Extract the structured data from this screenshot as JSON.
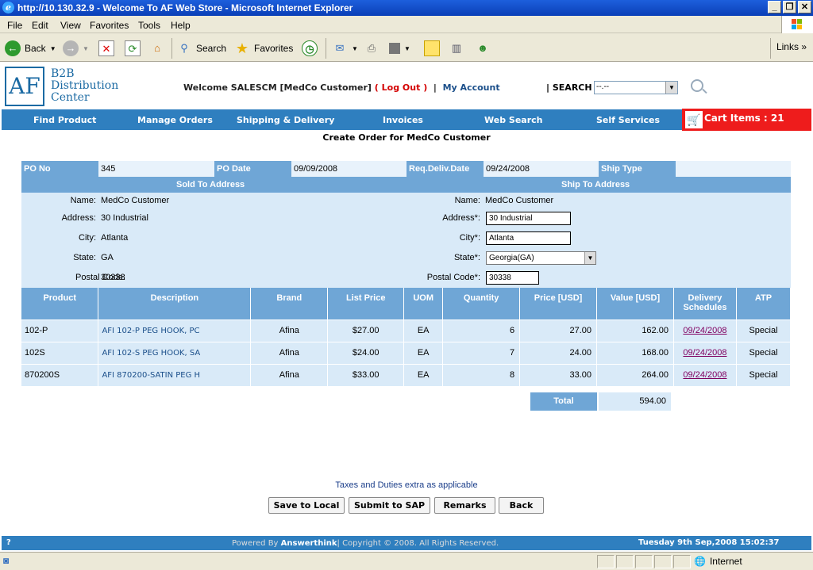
{
  "window": {
    "title": "http://10.130.32.9 - Welcome To AF Web Store - Microsoft Internet Explorer"
  },
  "menubar": [
    "File",
    "Edit",
    "View",
    "Favorites",
    "Tools",
    "Help"
  ],
  "toolbar": {
    "back": "Back",
    "search": "Search",
    "favorites": "Favorites",
    "links": "Links"
  },
  "header": {
    "logo_mark": "AF",
    "logo_line1": "B2B",
    "logo_line2": "Distribution",
    "logo_line3": "Center",
    "welcome": "Welcome SALESCM [MedCo Customer]",
    "logout": "( Log Out )",
    "sep1": "|",
    "my_account": "My Account",
    "sep2": "|",
    "search_label": "SEARCH",
    "search_value": "--.--"
  },
  "nav": {
    "items": [
      "Find Product",
      "Manage Orders",
      "Shipping & Delivery",
      "Invoices",
      "Web Search",
      "Self Services"
    ],
    "cart_label": "Cart Items : 21"
  },
  "page_title": "Create Order for MedCo Customer",
  "po": {
    "po_no_label": "PO No",
    "po_no": "345",
    "po_date_label": "PO Date",
    "po_date": "09/09/2008",
    "req_label": "Req.Deliv.Date",
    "req_date": "09/24/2008",
    "ship_type_label": "Ship Type",
    "ship_type": ""
  },
  "sold_to": {
    "heading": "Sold To Address",
    "name_label": "Name:",
    "name": "MedCo Customer",
    "address_label": "Address:",
    "address": "30 Industrial",
    "city_label": "City:",
    "city": "Atlanta",
    "state_label": "State:",
    "state": "GA",
    "postal_label": "Postal Code:",
    "postal": "30338"
  },
  "ship_to": {
    "heading": "Ship To Address",
    "name_label": "Name:",
    "name": "MedCo Customer",
    "address_label": "Address*:",
    "address": "30 Industrial",
    "city_label": "City*:",
    "city": "Atlanta",
    "state_label": "State*:",
    "state": "Georgia(GA)",
    "postal_label": "Postal Code*:",
    "postal": "30338"
  },
  "table": {
    "headers": [
      "Product",
      "Description",
      "Brand",
      "List Price",
      "UOM",
      "Quantity",
      "Price [USD]",
      "Value [USD]",
      "Delivery Schedules",
      "ATP"
    ],
    "rows": [
      [
        "102-P",
        "AFI 102-P PEG HOOK, PC",
        "Afina",
        "$27.00",
        "EA",
        "6",
        "27.00",
        "162.00",
        "09/24/2008",
        "Special"
      ],
      [
        "102S",
        "AFI 102-S PEG HOOK, SA",
        "Afina",
        "$24.00",
        "EA",
        "7",
        "24.00",
        "168.00",
        "09/24/2008",
        "Special"
      ],
      [
        "870200S",
        "AFI 870200-SATIN PEG H",
        "Afina",
        "$33.00",
        "EA",
        "8",
        "33.00",
        "264.00",
        "09/24/2008",
        "Special"
      ]
    ]
  },
  "total": {
    "label": "Total",
    "value": "594.00"
  },
  "taxes_note": "Taxes and Duties extra as applicable",
  "buttons": {
    "save": "Save to Local",
    "submit": "Submit to SAP",
    "remarks": "Remarks",
    "back": "Back"
  },
  "footer": {
    "help": "?",
    "powered_prefix": "Powered By",
    "brand": "Answerthink",
    "copyright": "| Copyright © 2008. All Rights Reserved.",
    "datetime": "Tuesday 9th Sep,2008 15:02:37"
  },
  "status": {
    "zone": "Internet"
  },
  "colors": {
    "nav_blue": "#2f7fbf",
    "header_blue": "#6fa6d6",
    "light_blue": "#d9eaf8",
    "cart_red": "#ee1c1c"
  }
}
